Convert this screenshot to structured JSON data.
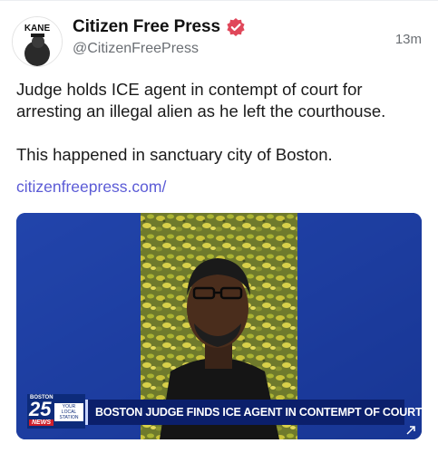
{
  "author": {
    "display_name": "Citizen Free Press",
    "handle": "@CitizenFreePress",
    "avatar_text": "KANE",
    "verified_icon": "verified-badge-icon"
  },
  "post": {
    "timestamp": "13m",
    "paragraphs": [
      "Judge holds ICE agent in contempt of court for arresting an illegal alien as he left the courthouse.",
      "This happened in sanctuary city of Boston."
    ],
    "link_text": "citizenfreepress.com/"
  },
  "media": {
    "station_city": "BOSTON",
    "station_number": "25",
    "station_tagline": "YOUR LOCAL STATION",
    "station_news": "NEWS",
    "headline": "BOSTON JUDGE FINDS ICE AGENT IN CONTEMPT OF COURT"
  },
  "colors": {
    "link": "#5b5bd6",
    "verified": "#e0475a",
    "tv_blue": "#0b1f6b",
    "news_red": "#d0202b"
  }
}
